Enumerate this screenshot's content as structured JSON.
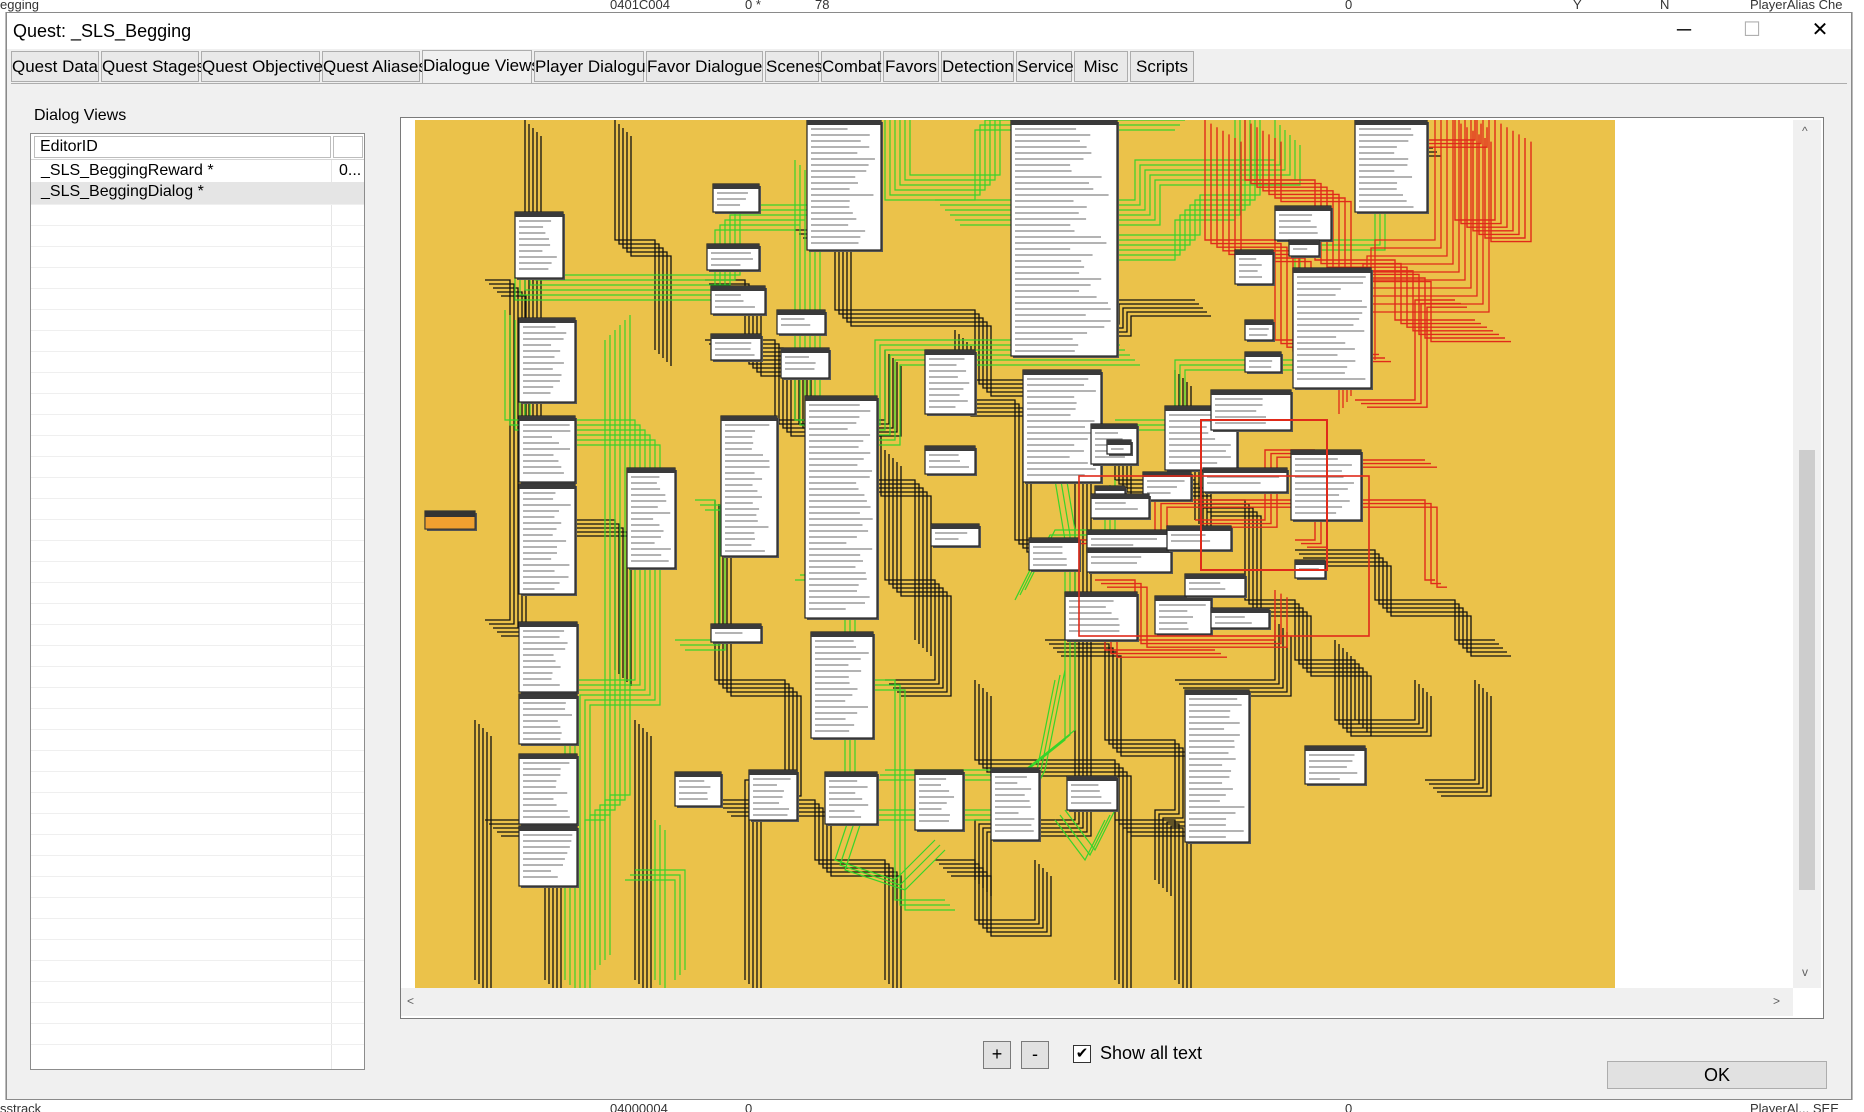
{
  "window": {
    "title": "Quest: _SLS_Begging",
    "minimize_glyph": "─",
    "maximize_glyph": "☐",
    "close_glyph": "✕"
  },
  "background_text": {
    "top_left": "egging",
    "top_id": "0401C004",
    "top_val1": "0 *",
    "top_val2": "78",
    "top_val3": "0",
    "top_val4": "Y",
    "top_val5": "N",
    "top_right": "PlayerAlias  Che",
    "bottom_left": "sstrack",
    "bottom_id": "04000004",
    "bottom_val1": "0",
    "bottom_val2": "0",
    "bottom_right": "PlayerAl... SEE"
  },
  "tabs": [
    {
      "label": "Quest Data"
    },
    {
      "label": "Quest Stages"
    },
    {
      "label": "Quest Objectives"
    },
    {
      "label": "Quest Aliases"
    },
    {
      "label": "Dialogue Views"
    },
    {
      "label": "Player Dialogue"
    },
    {
      "label": "Favor Dialogue"
    },
    {
      "label": "Scenes"
    },
    {
      "label": "Combat"
    },
    {
      "label": "Favors"
    },
    {
      "label": "Detection"
    },
    {
      "label": "Service"
    },
    {
      "label": "Misc"
    },
    {
      "label": "Scripts"
    }
  ],
  "active_tab": "Dialogue Views",
  "dialog_views": {
    "label": "Dialog Views",
    "column_header": "EditorID",
    "rows": [
      {
        "editor_id": "_SLS_BeggingReward *",
        "col2": "0..."
      },
      {
        "editor_id": "_SLS_BeggingDialog *",
        "col2": ""
      }
    ],
    "selected_row": 1
  },
  "canvas": {
    "background_color": "#ebc24a",
    "green_line_color": "#37d42a",
    "red_line_color": "#e02a1a",
    "black_line_color": "#111111",
    "node_fill": "#ffffff",
    "node_header_fill": "#3a3a3a",
    "up_arrow": "^",
    "down_arrow": "v",
    "left_arrow": "<",
    "right_arrow": ">"
  },
  "controls": {
    "zoom_in_label": "+",
    "zoom_out_label": "-",
    "show_all_text_label": "Show all text",
    "show_all_text_checked": true,
    "check_glyph": "✔",
    "ok_label": "OK"
  }
}
